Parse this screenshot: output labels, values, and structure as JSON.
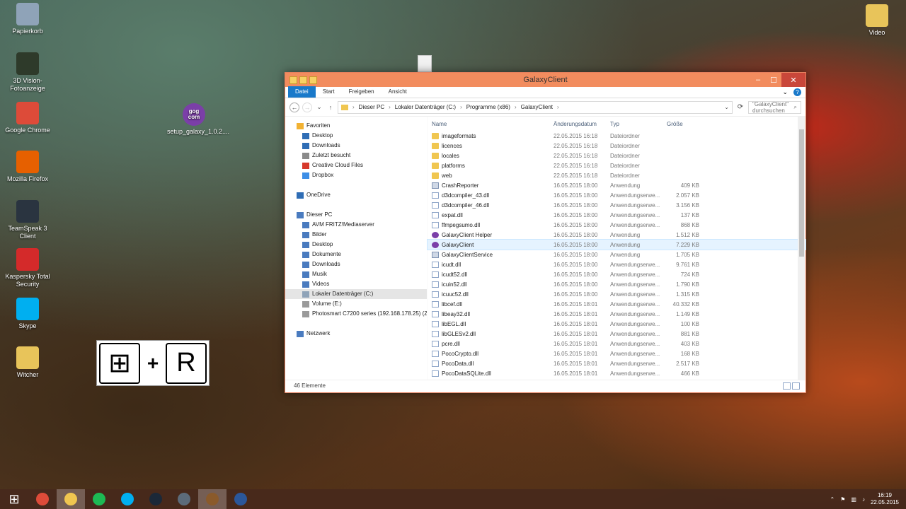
{
  "desktop": {
    "icons": [
      {
        "label": "Papierkorb",
        "icon": "recycle-bin-icon",
        "color": "#8fa3b8"
      },
      {
        "label": "3D Vision-Fotoanzeige",
        "icon": "3d-vision-icon",
        "color": "#2e3a2a"
      },
      {
        "label": "Google Chrome",
        "icon": "chrome-icon",
        "color": "#dd4b39"
      },
      {
        "label": "Mozilla Firefox",
        "icon": "firefox-icon",
        "color": "#e66000"
      },
      {
        "label": "TeamSpeak 3 Client",
        "icon": "teamspeak-icon",
        "color": "#2a3440"
      },
      {
        "label": "Kaspersky Total Security",
        "icon": "kaspersky-icon",
        "color": "#d42a2a"
      },
      {
        "label": "Skype",
        "icon": "skype-icon",
        "color": "#00aff0"
      },
      {
        "label": "Witcher",
        "icon": "folder-icon",
        "color": "#e8c45a"
      }
    ],
    "setup_icon": {
      "label": "setup_galaxy_1.0.2....",
      "badge": "gog com"
    },
    "video_icon": {
      "label": "Video"
    }
  },
  "shortcut_hint": {
    "key1": "⊞",
    "plus": "+",
    "key2": "R"
  },
  "explorer": {
    "title": "GalaxyClient",
    "ribbon_tabs": [
      "Datei",
      "Start",
      "Freigeben",
      "Ansicht"
    ],
    "address": [
      "Dieser PC",
      "Lokaler Datenträger (C:)",
      "Programme (x86)",
      "GalaxyClient"
    ],
    "search_placeholder": "\"GalaxyClient\" durchsuchen",
    "nav": {
      "favorites_label": "Favoriten",
      "favorites": [
        "Desktop",
        "Downloads",
        "Zuletzt besucht",
        "Creative Cloud Files",
        "Dropbox"
      ],
      "onedrive": "OneDrive",
      "pc_label": "Dieser PC",
      "pc_items": [
        "AVM FRITZ!Mediaserver",
        "Bilder",
        "Desktop",
        "Dokumente",
        "Downloads",
        "Musik",
        "Videos",
        "Lokaler Datenträger (C:)",
        "Volume (E:)",
        "Photosmart C7200 series (192.168.178.25) (Z:"
      ],
      "network": "Netzwerk"
    },
    "columns": {
      "name": "Name",
      "date": "Änderungsdatum",
      "type": "Typ",
      "size": "Größe"
    },
    "files": [
      {
        "name": "imageformats",
        "date": "22.05.2015 16:18",
        "type": "Dateiordner",
        "size": "",
        "kind": "folder"
      },
      {
        "name": "licences",
        "date": "22.05.2015 16:18",
        "type": "Dateiordner",
        "size": "",
        "kind": "folder"
      },
      {
        "name": "locales",
        "date": "22.05.2015 16:18",
        "type": "Dateiordner",
        "size": "",
        "kind": "folder"
      },
      {
        "name": "platforms",
        "date": "22.05.2015 16:18",
        "type": "Dateiordner",
        "size": "",
        "kind": "folder"
      },
      {
        "name": "web",
        "date": "22.05.2015 16:18",
        "type": "Dateiordner",
        "size": "",
        "kind": "folder"
      },
      {
        "name": "CrashReporter",
        "date": "16.05.2015 18:00",
        "type": "Anwendung",
        "size": "409 KB",
        "kind": "app"
      },
      {
        "name": "d3dcompiler_43.dll",
        "date": "16.05.2015 18:00",
        "type": "Anwendungserwe...",
        "size": "2.057 KB",
        "kind": "dll"
      },
      {
        "name": "d3dcompiler_46.dll",
        "date": "16.05.2015 18:00",
        "type": "Anwendungserwe...",
        "size": "3.156 KB",
        "kind": "dll"
      },
      {
        "name": "expat.dll",
        "date": "16.05.2015 18:00",
        "type": "Anwendungserwe...",
        "size": "137 KB",
        "kind": "dll"
      },
      {
        "name": "ffmpegsumo.dll",
        "date": "16.05.2015 18:00",
        "type": "Anwendungserwe...",
        "size": "868 KB",
        "kind": "dll"
      },
      {
        "name": "GalaxyClient Helper",
        "date": "16.05.2015 18:00",
        "type": "Anwendung",
        "size": "1.512 KB",
        "kind": "gog"
      },
      {
        "name": "GalaxyClient",
        "date": "16.05.2015 18:00",
        "type": "Anwendung",
        "size": "7.229 KB",
        "kind": "gog",
        "selected": true
      },
      {
        "name": "GalaxyClientService",
        "date": "16.05.2015 18:00",
        "type": "Anwendung",
        "size": "1.705 KB",
        "kind": "app"
      },
      {
        "name": "icudt.dll",
        "date": "16.05.2015 18:00",
        "type": "Anwendungserwe...",
        "size": "9.761 KB",
        "kind": "dll"
      },
      {
        "name": "icudt52.dll",
        "date": "16.05.2015 18:00",
        "type": "Anwendungserwe...",
        "size": "724 KB",
        "kind": "dll"
      },
      {
        "name": "icuin52.dll",
        "date": "16.05.2015 18:00",
        "type": "Anwendungserwe...",
        "size": "1.790 KB",
        "kind": "dll"
      },
      {
        "name": "icuuc52.dll",
        "date": "16.05.2015 18:00",
        "type": "Anwendungserwe...",
        "size": "1.315 KB",
        "kind": "dll"
      },
      {
        "name": "libcef.dll",
        "date": "16.05.2015 18:01",
        "type": "Anwendungserwe...",
        "size": "40.332 KB",
        "kind": "dll"
      },
      {
        "name": "libeay32.dll",
        "date": "16.05.2015 18:01",
        "type": "Anwendungserwe...",
        "size": "1.149 KB",
        "kind": "dll"
      },
      {
        "name": "libEGL.dll",
        "date": "16.05.2015 18:01",
        "type": "Anwendungserwe...",
        "size": "100 KB",
        "kind": "dll"
      },
      {
        "name": "libGLESv2.dll",
        "date": "16.05.2015 18:01",
        "type": "Anwendungserwe...",
        "size": "881 KB",
        "kind": "dll"
      },
      {
        "name": "pcre.dll",
        "date": "16.05.2015 18:01",
        "type": "Anwendungserwe...",
        "size": "403 KB",
        "kind": "dll"
      },
      {
        "name": "PocoCrypto.dll",
        "date": "16.05.2015 18:01",
        "type": "Anwendungserwe...",
        "size": "168 KB",
        "kind": "dll"
      },
      {
        "name": "PocoData.dll",
        "date": "16.05.2015 18:01",
        "type": "Anwendungserwe...",
        "size": "2.517 KB",
        "kind": "dll"
      },
      {
        "name": "PocoDataSQLite.dll",
        "date": "16.05.2015 18:01",
        "type": "Anwendungserwe...",
        "size": "466 KB",
        "kind": "dll"
      }
    ],
    "status": "46 Elemente"
  },
  "taskbar": {
    "apps": [
      {
        "name": "chrome",
        "color": "#dd4b39"
      },
      {
        "name": "explorer",
        "color": "#f0c650",
        "active": true
      },
      {
        "name": "spotify",
        "color": "#1db954"
      },
      {
        "name": "skype",
        "color": "#00aff0"
      },
      {
        "name": "steam",
        "color": "#1b2838"
      },
      {
        "name": "teamspeak",
        "color": "#5c6b7a"
      },
      {
        "name": "gog-galaxy",
        "color": "#8a5a2b",
        "active": true
      },
      {
        "name": "word",
        "color": "#2b579a"
      }
    ],
    "time": "16:19",
    "date": "22.05.2015"
  }
}
